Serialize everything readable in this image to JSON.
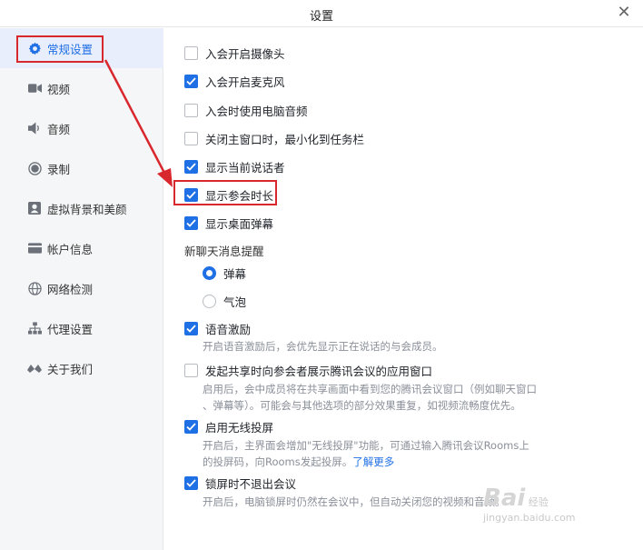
{
  "window": {
    "title": "设置",
    "close": "✕"
  },
  "sidebar": {
    "items": [
      {
        "label": "常规设置",
        "icon": "gear-icon",
        "active": true
      },
      {
        "label": "视频",
        "icon": "camera-icon"
      },
      {
        "label": "音频",
        "icon": "speaker-icon"
      },
      {
        "label": "录制",
        "icon": "record-icon"
      },
      {
        "label": "虚拟背景和美颜",
        "icon": "portrait-icon"
      },
      {
        "label": "帐户信息",
        "icon": "card-icon"
      },
      {
        "label": "网络检测",
        "icon": "globe-icon"
      },
      {
        "label": "代理设置",
        "icon": "hierarchy-icon"
      },
      {
        "label": "关于我们",
        "icon": "logo-icon"
      }
    ]
  },
  "options": [
    {
      "label": "入会开启摄像头",
      "checked": false
    },
    {
      "label": "入会开启麦克风",
      "checked": true
    },
    {
      "label": "入会时使用电脑音频",
      "checked": false
    },
    {
      "label": "关闭主窗口时，最小化到任务栏",
      "checked": false
    },
    {
      "label": "显示当前说话者",
      "checked": true
    },
    {
      "label": "显示参会时长",
      "checked": true
    },
    {
      "label": "显示桌面弹幕",
      "checked": true
    }
  ],
  "chat_notice": {
    "label": "新聊天消息提醒",
    "options": [
      {
        "label": "弹幕",
        "selected": true
      },
      {
        "label": "气泡",
        "selected": false
      }
    ]
  },
  "more_options": [
    {
      "label": "语音激励",
      "checked": true,
      "desc": [
        "开启语音激励后，会优先显示正在说话的与会成员。"
      ]
    },
    {
      "label": "发起共享时向参会者展示腾讯会议的应用窗口",
      "checked": false,
      "desc": [
        "启用后，会中成员将在共享画面中看到您的腾讯会议窗口（例如聊天窗口",
        "、弹幕等）。可能会与其他选项的部分效果重复，如视频流畅度优先。"
      ]
    },
    {
      "label": "启用无线投屏",
      "checked": true,
      "desc": [
        "开启后，主界面会增加\"无线投屏\"功能，可通过输入腾讯会议Rooms上",
        "的投屏码，向Rooms发起投屏。"
      ],
      "link": "了解更多"
    },
    {
      "label": "锁屏时不退出会议",
      "checked": true,
      "desc": [
        "开启后，电脑锁屏时仍然在会议中，但自动关闭您的视频和音频。"
      ]
    }
  ],
  "watermark": {
    "brand": "Bai",
    "brand2": "经验",
    "url": "jingyan.baidu.com"
  },
  "colors": {
    "accent": "#1f6fe5",
    "highlight": "#d9272e"
  }
}
